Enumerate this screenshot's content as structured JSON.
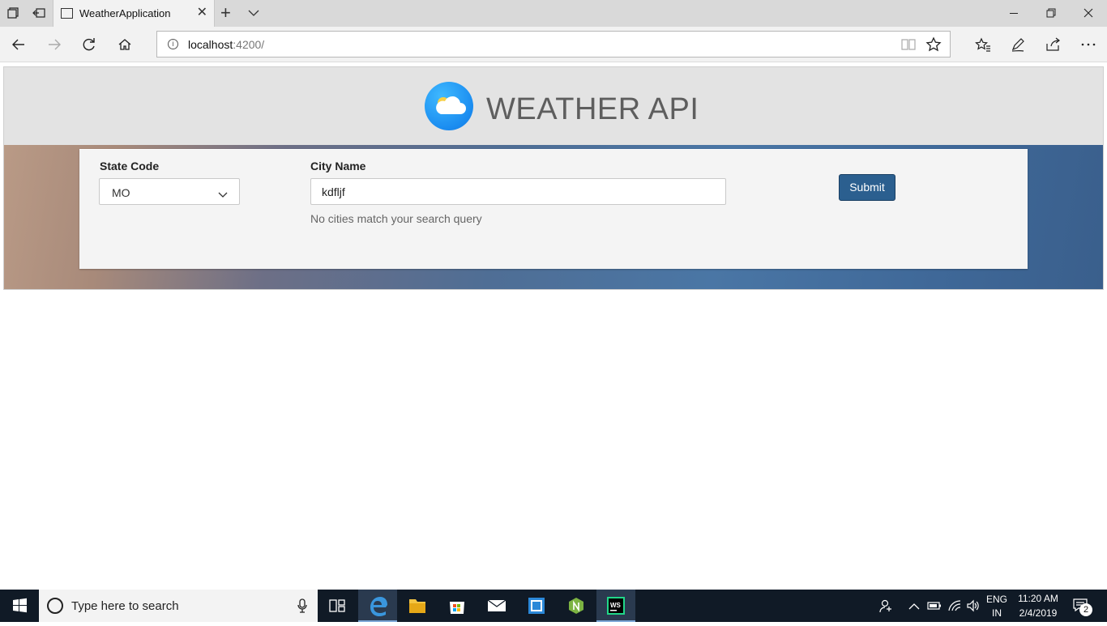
{
  "browser": {
    "tab_title": "WeatherApplication",
    "address_host": "localhost",
    "address_path": ":4200/"
  },
  "page": {
    "title": "WEATHER API",
    "form": {
      "state_label": "State Code",
      "state_value": "MO",
      "city_label": "City Name",
      "city_value": "kdfljf",
      "no_match_text": "No cities match your search query",
      "submit_label": "Submit"
    }
  },
  "taskbar": {
    "search_placeholder": "Type here to search",
    "lang_top": "ENG",
    "lang_bottom": "IN",
    "time": "11:20 AM",
    "date": "2/4/2019",
    "notifications": "2"
  },
  "colors": {
    "submit": "#2b5f8f",
    "header_bg": "#e3e3e3",
    "taskbar": "#101a26"
  }
}
